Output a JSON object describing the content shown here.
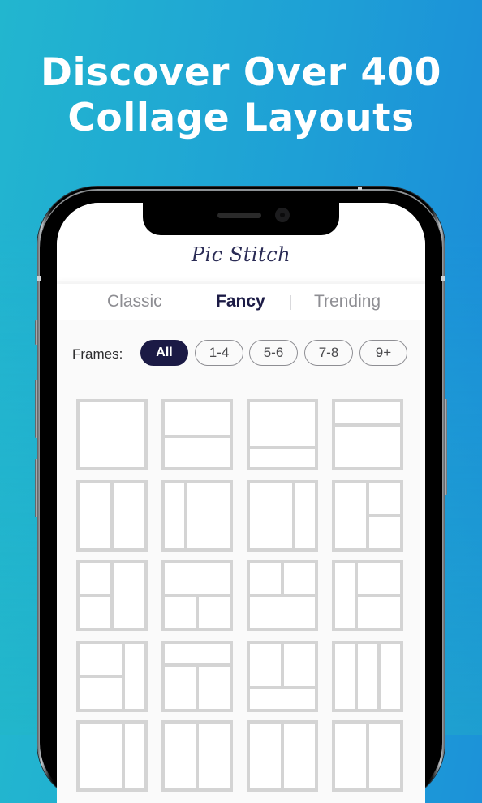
{
  "headline": {
    "line1": "Discover Over 400",
    "line2": "Collage Layouts"
  },
  "phone": {
    "notch_icons": [
      "speaker-grille",
      "front-camera"
    ]
  },
  "app": {
    "title": "Pic Stitch",
    "tabs": [
      {
        "label": "Classic",
        "active": false
      },
      {
        "label": "Fancy",
        "active": true
      },
      {
        "label": "Trending",
        "active": false
      }
    ],
    "frames_filter": {
      "label": "Frames:",
      "options": [
        {
          "label": "All",
          "active": true
        },
        {
          "label": "1-4",
          "active": false
        },
        {
          "label": "5-6",
          "active": false
        },
        {
          "label": "7-8",
          "active": false
        },
        {
          "label": "9+",
          "active": false
        }
      ]
    },
    "layouts": [
      {
        "name": "single"
      },
      {
        "name": "two-rows-equal"
      },
      {
        "name": "two-rows-top-large"
      },
      {
        "name": "two-rows-bottom-large"
      },
      {
        "name": "two-cols-equal"
      },
      {
        "name": "two-cols-right-large"
      },
      {
        "name": "two-cols-left-large"
      },
      {
        "name": "left-col-right-split"
      },
      {
        "name": "left-split-right-col"
      },
      {
        "name": "top-row-bottom-split"
      },
      {
        "name": "top-split-bottom-row"
      },
      {
        "name": "narrow-left-right-split"
      },
      {
        "name": "left-split-narrow-right"
      },
      {
        "name": "top-row-bottom-split-tall"
      },
      {
        "name": "top-split-tall-bottom-row"
      },
      {
        "name": "three-cols"
      },
      {
        "name": "partial-row-5-a"
      },
      {
        "name": "partial-row-5-b"
      },
      {
        "name": "partial-row-5-c"
      },
      {
        "name": "partial-row-5-d"
      }
    ],
    "colors": {
      "accent": "#1b1a45",
      "tile_border": "#d4d4d4",
      "inactive_tab": "#8e8e93"
    }
  }
}
